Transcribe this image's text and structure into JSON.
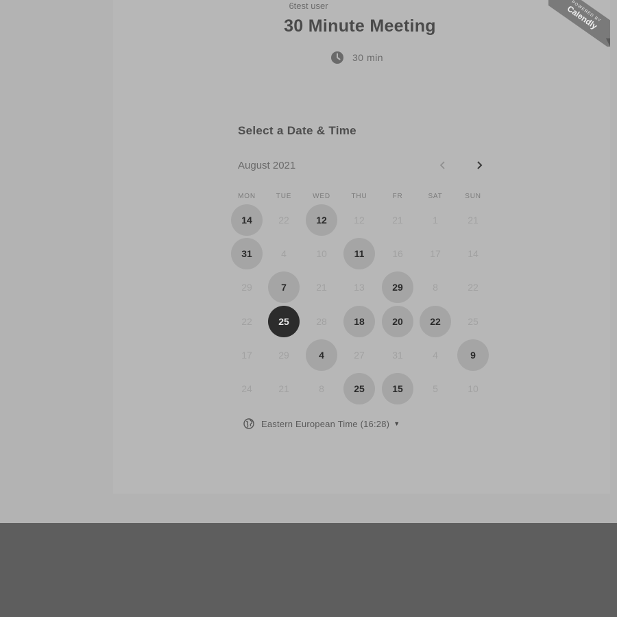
{
  "ribbon": {
    "sub": "POWERED BY",
    "brand": "Calendly"
  },
  "header": {
    "org_name": "6test user",
    "event_title": "30 Minute Meeting",
    "duration_icon": "clock-icon",
    "duration": "30 min"
  },
  "calendar": {
    "section_title": "Select a Date & Time",
    "month": "August 2021",
    "prev_icon": "chevron-left-icon",
    "next_icon": "chevron-right-icon",
    "weekdays": [
      "MON",
      "TUE",
      "WED",
      "THU",
      "FR",
      "SAT",
      "SUN"
    ],
    "weeks": [
      [
        {
          "label": "14",
          "state": "available"
        },
        {
          "label": "22",
          "state": "unavailable"
        },
        {
          "label": "12",
          "state": "available"
        },
        {
          "label": "12",
          "state": "unavailable"
        },
        {
          "label": "21",
          "state": "unavailable"
        },
        {
          "label": "1",
          "state": "unavailable"
        },
        {
          "label": "21",
          "state": "unavailable"
        }
      ],
      [
        {
          "label": "31",
          "state": "available"
        },
        {
          "label": "4",
          "state": "unavailable"
        },
        {
          "label": "10",
          "state": "unavailable"
        },
        {
          "label": "11",
          "state": "available"
        },
        {
          "label": "16",
          "state": "unavailable"
        },
        {
          "label": "17",
          "state": "unavailable"
        },
        {
          "label": "14",
          "state": "unavailable"
        }
      ],
      [
        {
          "label": "29",
          "state": "unavailable"
        },
        {
          "label": "7",
          "state": "available"
        },
        {
          "label": "21",
          "state": "unavailable"
        },
        {
          "label": "13",
          "state": "unavailable"
        },
        {
          "label": "29",
          "state": "available"
        },
        {
          "label": "8",
          "state": "unavailable"
        },
        {
          "label": "22",
          "state": "unavailable"
        }
      ],
      [
        {
          "label": "22",
          "state": "unavailable"
        },
        {
          "label": "25",
          "state": "selected"
        },
        {
          "label": "28",
          "state": "unavailable"
        },
        {
          "label": "18",
          "state": "available"
        },
        {
          "label": "20",
          "state": "available"
        },
        {
          "label": "22",
          "state": "available"
        },
        {
          "label": "25",
          "state": "unavailable"
        }
      ],
      [
        {
          "label": "17",
          "state": "unavailable"
        },
        {
          "label": "29",
          "state": "unavailable"
        },
        {
          "label": "4",
          "state": "available"
        },
        {
          "label": "27",
          "state": "unavailable"
        },
        {
          "label": "31",
          "state": "unavailable"
        },
        {
          "label": "4",
          "state": "unavailable"
        },
        {
          "label": "9",
          "state": "available"
        }
      ],
      [
        {
          "label": "24",
          "state": "unavailable"
        },
        {
          "label": "21",
          "state": "unavailable"
        },
        {
          "label": "8",
          "state": "unavailable"
        },
        {
          "label": "25",
          "state": "available"
        },
        {
          "label": "15",
          "state": "available"
        },
        {
          "label": "5",
          "state": "unavailable"
        },
        {
          "label": "10",
          "state": "unavailable"
        }
      ]
    ]
  },
  "timezone": {
    "icon": "globe-icon",
    "label": "Eastern European Time (16:28)",
    "caret_icon": "caret-down-icon"
  }
}
